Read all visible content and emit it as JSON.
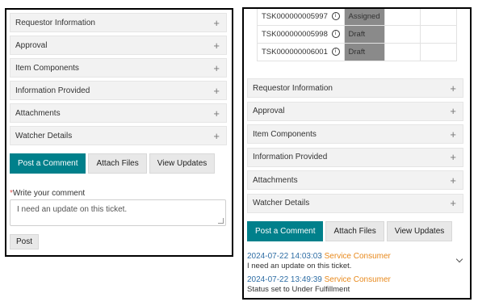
{
  "colors": {
    "primary_button": "#00808b",
    "state_badge": "#8a8a8a",
    "link_date": "#2e6da4",
    "user_name": "#e8891c",
    "required_marker": "#d9534f"
  },
  "left": {
    "sections": [
      {
        "label": "Requestor Information"
      },
      {
        "label": "Approval"
      },
      {
        "label": "Item Components"
      },
      {
        "label": "Information Provided"
      },
      {
        "label": "Attachments"
      },
      {
        "label": "Watcher Details"
      }
    ],
    "buttons": {
      "post_comment": "Post a Comment",
      "attach_files": "Attach Files",
      "view_updates": "View Updates"
    },
    "comment_required_mark": "*",
    "comment_label": "Write your comment",
    "comment_value": "I need an update on this ticket.",
    "post_label": "Post"
  },
  "right": {
    "tasks": [
      {
        "id": "TSK000000005997",
        "state": "Assigned"
      },
      {
        "id": "TSK000000005998",
        "state": "Draft"
      },
      {
        "id": "TSK000000006001",
        "state": "Draft"
      }
    ],
    "sections": [
      {
        "label": "Requestor Information"
      },
      {
        "label": "Approval"
      },
      {
        "label": "Item Components"
      },
      {
        "label": "Information Provided"
      },
      {
        "label": "Attachments"
      },
      {
        "label": "Watcher Details"
      }
    ],
    "buttons": {
      "post_comment": "Post a Comment",
      "attach_files": "Attach Files",
      "view_updates": "View Updates"
    },
    "activity": [
      {
        "date": "2024-07-22 14:03:03",
        "user": "Service Consumer",
        "text": "I need an update on this ticket."
      },
      {
        "date": "2024-07-22 13:49:39",
        "user": "Service Consumer",
        "text": "Status set to Under Fulfillment"
      }
    ]
  }
}
